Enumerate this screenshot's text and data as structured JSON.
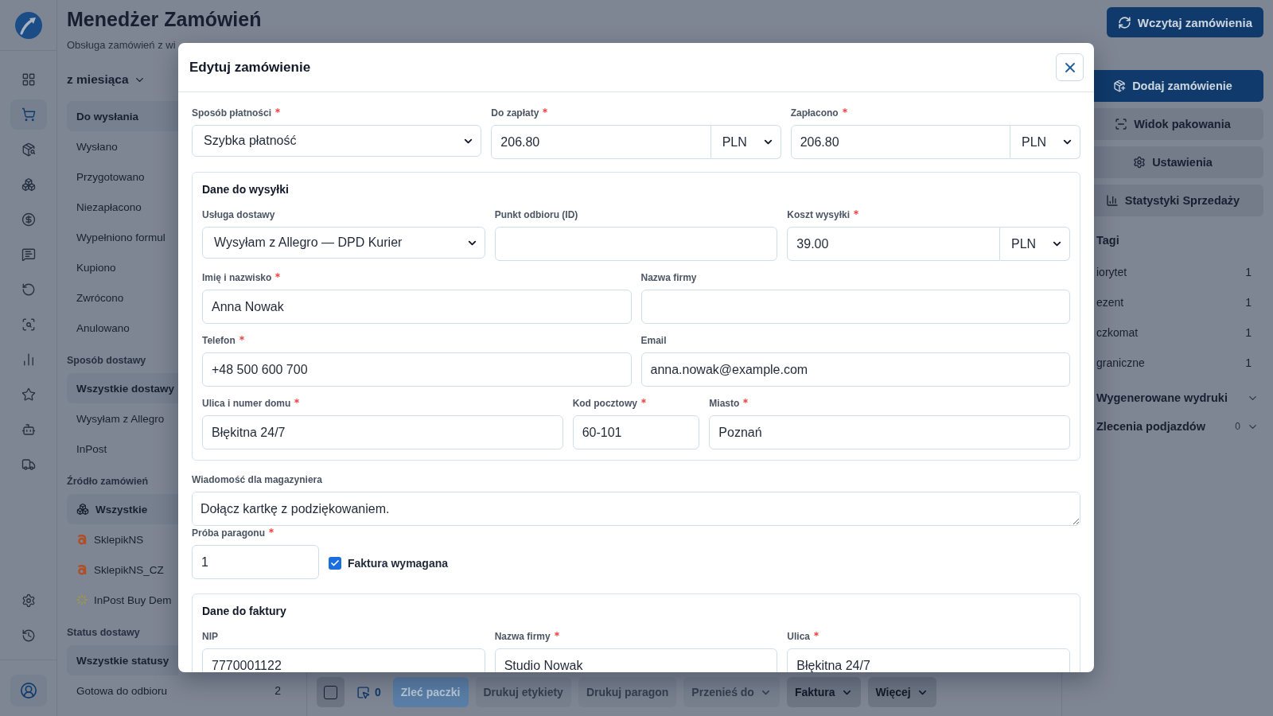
{
  "rail": {
    "items": [
      {
        "selected": false
      },
      {
        "selected": true
      },
      {
        "selected": false
      },
      {
        "selected": false
      },
      {
        "selected": false
      },
      {
        "selected": false
      },
      {
        "selected": false
      },
      {
        "selected": false
      },
      {
        "selected": false
      },
      {
        "selected": false
      },
      {
        "selected": false
      },
      {
        "selected": false
      }
    ],
    "bottom_items": [
      {
        "selected": false
      },
      {
        "selected": false
      }
    ]
  },
  "header": {
    "title": "Menedżer Zamówień",
    "subtitle": "Obsługa zamówień z wi",
    "load_button": "Wczytaj zamówienia"
  },
  "filters": {
    "period": "z miesiąca",
    "statuses": [
      {
        "label": "Do wysłania",
        "selected": true
      },
      {
        "label": "Wysłano",
        "selected": false
      },
      {
        "label": "Przygotowano",
        "selected": false
      },
      {
        "label": "Niezapłacono",
        "selected": false
      },
      {
        "label": "Wypełniono formul",
        "selected": false
      },
      {
        "label": "Kupiono",
        "selected": false
      },
      {
        "label": "Zwrócono",
        "selected": false
      },
      {
        "label": "Anulowano",
        "selected": false
      }
    ],
    "sections": [
      {
        "title": "Sposób dostawy",
        "items": [
          {
            "label": "Wszystkie dostawy",
            "selected": true
          },
          {
            "label": "Wysyłam z Allegro",
            "selected": false
          },
          {
            "label": "InPost",
            "selected": false
          }
        ]
      },
      {
        "title": "Źródło zamówień",
        "items": [
          {
            "label": "Wszystkie",
            "kind": "all",
            "selected": true
          },
          {
            "label": "SklepikNS",
            "kind": "marketplace",
            "selected": false
          },
          {
            "label": "SklepikNS_CZ",
            "kind": "marketplace",
            "selected": false
          },
          {
            "label": "InPost Buy Dem",
            "kind": "locker",
            "selected": false
          }
        ]
      },
      {
        "title": "Status dostawy",
        "items": [
          {
            "label": "Wszystkie statusy",
            "selected": true
          },
          {
            "label": "Gotowa do odbioru",
            "selected": false,
            "count": "2"
          }
        ]
      }
    ]
  },
  "toolbar": {
    "select_all": {
      "checked": false
    },
    "selected_count": "0",
    "buttons": [
      {
        "label": "Zleć paczki",
        "kind": "primary",
        "disabled": true
      },
      {
        "label": "Drukuj etykiety",
        "kind": "plain",
        "disabled": true
      },
      {
        "label": "Drukuj paragon",
        "kind": "plain",
        "disabled": true
      },
      {
        "label": "Przenieś do",
        "kind": "menu",
        "disabled": true
      },
      {
        "label": "Faktura",
        "kind": "menu",
        "disabled": false
      },
      {
        "label": "Więcej",
        "kind": "menu",
        "disabled": false
      }
    ]
  },
  "right_panel": {
    "actions": [
      {
        "label": "Dodaj zamówienie",
        "kind": "primary"
      },
      {
        "label": "Widok pakowania",
        "kind": "secondary"
      },
      {
        "label": "Ustawienia",
        "kind": "secondary"
      },
      {
        "label": "Statystyki Sprzedaży",
        "kind": "secondary"
      }
    ],
    "tags": {
      "title": "Tagi",
      "items": [
        {
          "label": "iorytet",
          "count": "1"
        },
        {
          "label": "ezent",
          "count": "1"
        },
        {
          "label": "czkomat",
          "count": "1"
        },
        {
          "label": "graniczne",
          "count": "1"
        }
      ]
    },
    "sections": [
      {
        "title": "Wygenerowane wydruki",
        "expanded": false
      },
      {
        "title": "Zlecenia podjazdów",
        "count": "0",
        "expanded": false
      }
    ]
  },
  "modal": {
    "title": "Edytuj zamówienie",
    "payment_fields": [
      {
        "label": "Sposób płatności",
        "required": true,
        "kind": "select",
        "value": "Szybka płatność"
      },
      {
        "label": "Do zapłaty",
        "required": true,
        "kind": "money",
        "value": "206.80",
        "currency": "PLN"
      },
      {
        "label": "Zapłacono",
        "required": true,
        "kind": "money",
        "value": "206.80",
        "currency": "PLN"
      }
    ],
    "shipping": {
      "title": "Dane do wysyłki",
      "rows": [
        [
          {
            "label": "Usługa dostawy",
            "required": false,
            "kind": "select",
            "value": "Wysyłam z Allegro — DPD Kurier"
          },
          {
            "label": "Punkt odbioru (ID)",
            "required": false,
            "kind": "text"
          },
          {
            "label": "Koszt wysyłki",
            "required": true,
            "kind": "money",
            "value": "39.00",
            "currency": "PLN"
          }
        ],
        [
          {
            "label": "Imię i nazwisko",
            "required": true,
            "kind": "text",
            "value": "Anna Nowak"
          },
          {
            "label": "Nazwa firmy",
            "required": false,
            "kind": "text"
          }
        ],
        [
          {
            "label": "Telefon",
            "required": true,
            "kind": "text",
            "value": "+48 500 600 700"
          },
          {
            "label": "Email",
            "required": false,
            "kind": "text",
            "value": "anna.nowak@example.com"
          }
        ],
        [
          {
            "label": "Ulica i numer domu",
            "required": true,
            "kind": "text",
            "value": "Błękitna 24/7"
          },
          {
            "label": "Kod pocztowy",
            "required": true,
            "kind": "text",
            "value": "60-101"
          },
          {
            "label": "Miasto",
            "required": true,
            "kind": "text",
            "value": "Poznań"
          }
        ]
      ]
    },
    "warehouse_note": {
      "label": "Wiadomość dla magazyniera",
      "required": false,
      "kind": "textarea",
      "value": "Dołącz kartkę z podziękowaniem."
    },
    "receipt_sample": {
      "label": "Próba paragonu",
      "required": true,
      "kind": "text",
      "value": "1"
    },
    "invoice_required": {
      "label": "Faktura wymagana",
      "checked": true
    },
    "invoice": {
      "title": "Dane do faktury",
      "rows": [
        [
          {
            "label": "NIP",
            "required": false,
            "kind": "text",
            "value": "7770001122"
          },
          {
            "label": "Nazwa firmy",
            "required": true,
            "kind": "text",
            "value": "Studio Nowak"
          },
          {
            "label": "Ulica",
            "required": true,
            "kind": "text",
            "value": "Błękitna 24/7"
          }
        ]
      ]
    }
  }
}
